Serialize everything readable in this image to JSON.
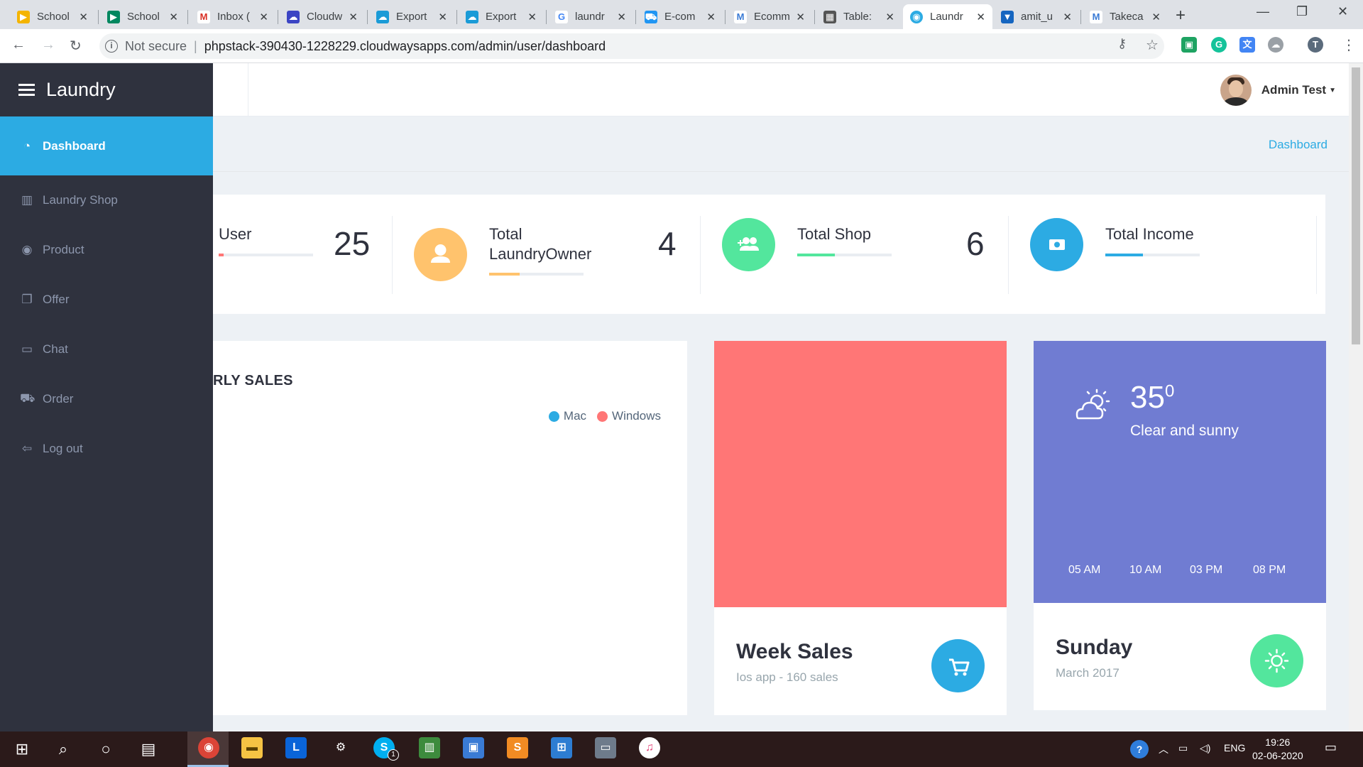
{
  "browser": {
    "tabs": [
      {
        "label": "School",
        "icon": "school-favicon",
        "color": "#f4b400"
      },
      {
        "label": "School",
        "icon": "play-store-favicon",
        "color": "#01875f"
      },
      {
        "label": "Inbox (",
        "icon": "gmail-favicon",
        "color": "#d93025"
      },
      {
        "label": "Cloudw",
        "icon": "cloudways-favicon",
        "color": "#3b44c4"
      },
      {
        "label": "Export",
        "icon": "cloud-favicon",
        "color": "#1a9bd7"
      },
      {
        "label": "Export",
        "icon": "cloud-favicon",
        "color": "#1a9bd7"
      },
      {
        "label": "laundr",
        "icon": "google-favicon",
        "color": "#4285f4"
      },
      {
        "label": "E-com",
        "icon": "cart-favicon",
        "color": "#2196f3"
      },
      {
        "label": "Ecomm",
        "icon": "m-favicon",
        "color": "#3a7bd5"
      },
      {
        "label": "Table:",
        "icon": "table-favicon",
        "color": "#555555"
      },
      {
        "label": "Laundr",
        "icon": "laundry-favicon",
        "color": "#2cabe3"
      },
      {
        "label": "amit_u",
        "icon": "shield-favicon",
        "color": "#1565c0"
      },
      {
        "label": "Takeca",
        "icon": "m-favicon",
        "color": "#3a7bd5"
      }
    ],
    "security_label": "Not secure",
    "url": "phpstack-390430-1228229.cloudwaysapps.com/admin/user/dashboard"
  },
  "sidebar": {
    "brand": "Laundry",
    "items": [
      {
        "label": "Dashboard",
        "icon": "dashboard-icon",
        "glyph": "◔"
      },
      {
        "label": "Laundry Shop",
        "icon": "shop-icon",
        "glyph": "▥"
      },
      {
        "label": "Product",
        "icon": "product-icon",
        "glyph": "◉"
      },
      {
        "label": "Offer",
        "icon": "gift-icon",
        "glyph": "❐"
      },
      {
        "label": "Chat",
        "icon": "chat-icon",
        "glyph": "▭"
      },
      {
        "label": "Order",
        "icon": "cart-icon",
        "glyph": "⛟"
      },
      {
        "label": "Log out",
        "icon": "logout-icon",
        "glyph": "⇦"
      }
    ]
  },
  "header": {
    "user_name": "Admin Test",
    "breadcrumb": "Dashboard"
  },
  "stats": [
    {
      "label": "User",
      "value": "25",
      "icon": "user-icon",
      "color": "#ff7676",
      "progress": 0.05
    },
    {
      "label": "Total LaundryOwner",
      "value": "4",
      "icon": "owner-icon",
      "color": "#ffc36d",
      "progress": 0.32
    },
    {
      "label": "Total Shop",
      "value": "6",
      "icon": "shop-group-icon",
      "color": "#53e69d",
      "progress": 0.4
    },
    {
      "label": "Total Income",
      "value": "",
      "icon": "money-icon",
      "color": "#2cabe3",
      "progress": 0.4
    }
  ],
  "sales_card": {
    "title": "RLY SALES",
    "legend": [
      {
        "label": "Mac",
        "color": "#2cabe3"
      },
      {
        "label": "Windows",
        "color": "#ff7676"
      }
    ]
  },
  "week_sales": {
    "title": "Week Sales",
    "subtitle": "Ios app - 160 sales",
    "panel_color": "#ff7676",
    "icon_color": "#2cabe3"
  },
  "weather": {
    "temperature": "35",
    "degree": "0",
    "description": "Clear and sunny",
    "times": [
      "05 AM",
      "10 AM",
      "03 PM",
      "08 PM"
    ],
    "day": "Sunday",
    "date": "March 2017",
    "panel_color": "#707cd2",
    "icon_color": "#53e69d"
  },
  "taskbar": {
    "language": "ENG",
    "time": "19:26",
    "date": "02-06-2020",
    "skype_badge": "1"
  }
}
